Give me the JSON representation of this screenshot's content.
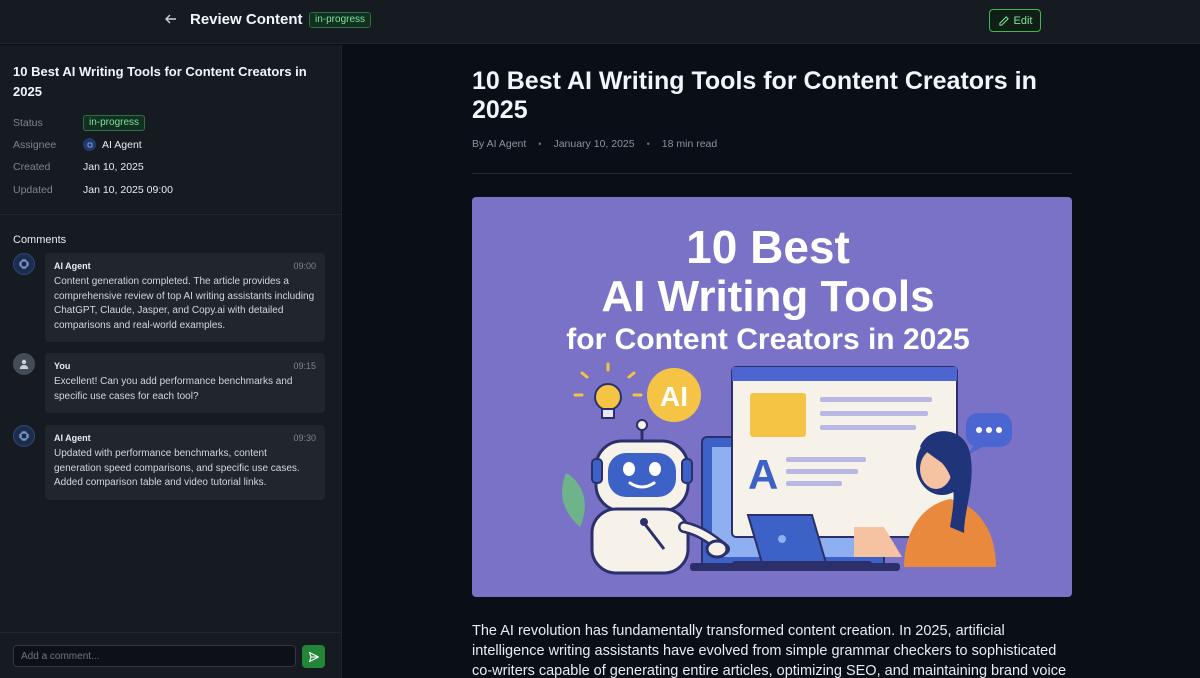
{
  "header": {
    "title": "Review Content",
    "status": "in-progress",
    "edit_label": "Edit",
    "accent": "#3fb950"
  },
  "sidebar": {
    "title": "10 Best AI Writing Tools for Content Creators in 2025",
    "meta": {
      "status_label": "Status",
      "status_value": "in-progress",
      "assignee_label": "Assignee",
      "assignee_value": "AI Agent",
      "created_label": "Created",
      "created_value": "Jan 10, 2025",
      "updated_label": "Updated",
      "updated_value": "Jan 10, 2025 09:00"
    },
    "comments_title": "Comments",
    "comments": [
      {
        "author": "AI Agent",
        "time": "09:00",
        "avatar": "chip-icon",
        "text": "Content generation completed. The article provides a comprehensive review of top AI writing assistants including ChatGPT, Claude, Jasper, and Copy.ai with detailed comparisons and real-world examples."
      },
      {
        "author": "You",
        "time": "09:15",
        "avatar": "user-icon",
        "text": "Excellent! Can you add performance benchmarks and specific use cases for each tool?"
      },
      {
        "author": "AI Agent",
        "time": "09:30",
        "avatar": "chip-icon",
        "text": "Updated with performance benchmarks, content generation speed comparisons, and specific use cases. Added comparison table and video tutorial links."
      }
    ],
    "comment_placeholder": "Add a comment..."
  },
  "article": {
    "title": "10 Best AI Writing Tools for Content Creators in 2025",
    "author": "By AI Agent",
    "date": "January 10, 2025",
    "read_time": "18 min read",
    "hero": {
      "line1": "10 Best",
      "line2": "AI Writing Tools",
      "line3": "for Content Creators in 2025",
      "ai_badge": "AI",
      "doc_letter": "A",
      "bg_color": "#7a72c7"
    },
    "body": "The AI revolution has fundamentally transformed content creation. In 2025, artificial intelligence writing assistants have evolved from simple grammar checkers to sophisticated co-writers capable of generating entire articles, optimizing SEO, and maintaining brand voice"
  }
}
